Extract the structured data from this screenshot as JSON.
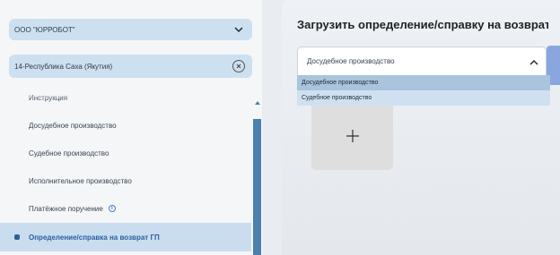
{
  "sidebar": {
    "org_select": {
      "value": "ООО \"ЮРРОБОТ\""
    },
    "region_select": {
      "value": "14-Республика Саха (Якутия)"
    },
    "items": [
      {
        "label": "Инструкция"
      },
      {
        "label": "Досудебное производство"
      },
      {
        "label": "Судебное производство"
      },
      {
        "label": "Исполнительное производство"
      },
      {
        "label": "Платёжное поручение"
      },
      {
        "label": "Определение/справка на возврат ГП"
      }
    ]
  },
  "main": {
    "title": "Загрузить определение/справку на возврат ГП",
    "dropdown": {
      "value": "Досудебное производство",
      "options": [
        {
          "label": "Досудебное производство"
        },
        {
          "label": "Судебное производство"
        }
      ]
    },
    "upload_icon": "plus-icon"
  },
  "colors": {
    "active_item_bg": "#c9ddee",
    "active_item_text": "#2b5fa6",
    "select_bg": "#cde0f0",
    "scroll_thumb": "#4b7fac"
  }
}
